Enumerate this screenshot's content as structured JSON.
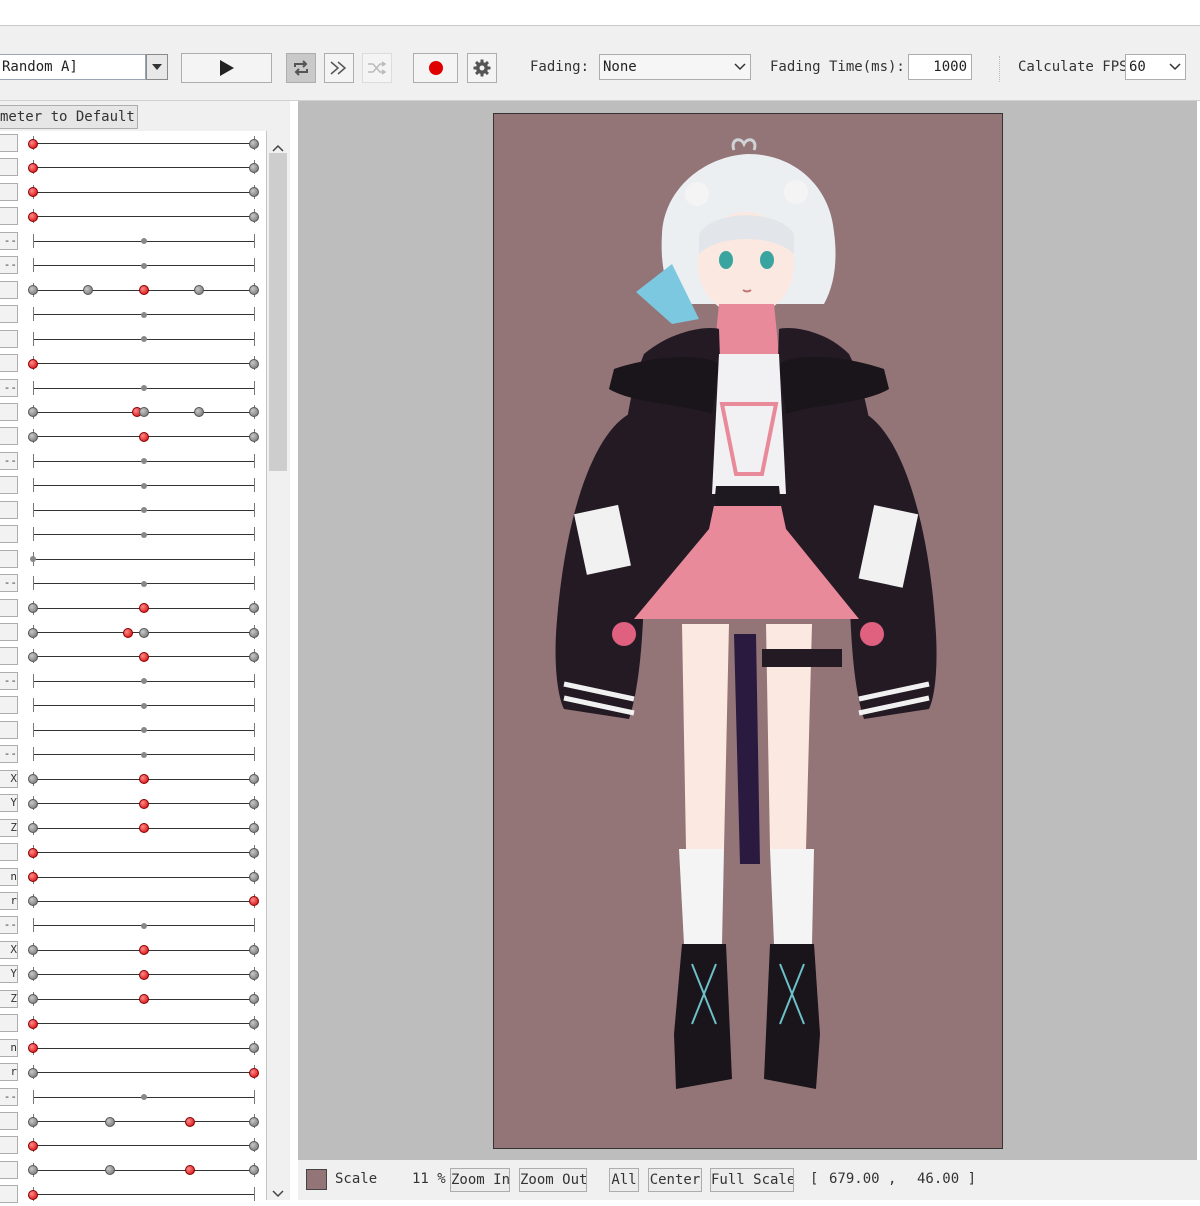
{
  "toolbar": {
    "motion_select": "Random A]",
    "fading_label": "Fading:",
    "fading_value": "None",
    "fading_time_label": "Fading Time(ms):",
    "fading_time_value": "1000",
    "fps_label": "Calculate FPS",
    "fps_value": "60",
    "play_icon": "play-icon",
    "loop_icon": "loop-icon",
    "skip_icon": "fast-forward-icon",
    "shuffle_icon": "shuffle-icon",
    "record_icon": "record-icon",
    "settings_icon": "gear-icon"
  },
  "left_panel": {
    "reset_button": "meter to Default",
    "rows": [
      {
        "suffix": "",
        "knobs": [
          {
            "v": 0,
            "c": "r"
          },
          {
            "v": 1,
            "c": "g"
          }
        ]
      },
      {
        "suffix": "",
        "knobs": [
          {
            "v": 0,
            "c": "r"
          },
          {
            "v": 1,
            "c": "g"
          }
        ]
      },
      {
        "suffix": "",
        "knobs": [
          {
            "v": 0,
            "c": "r"
          },
          {
            "v": 1,
            "c": "g"
          }
        ]
      },
      {
        "suffix": "",
        "knobs": [
          {
            "v": 0,
            "c": "r"
          },
          {
            "v": 1,
            "c": "g"
          }
        ]
      },
      {
        "suffix": "--",
        "knobs": [
          {
            "v": 0.5,
            "c": "m"
          }
        ]
      },
      {
        "suffix": "--",
        "knobs": [
          {
            "v": 0.5,
            "c": "m"
          }
        ]
      },
      {
        "suffix": "",
        "knobs": [
          {
            "v": 0,
            "c": "g"
          },
          {
            "v": 0.25,
            "c": "g"
          },
          {
            "v": 0.5,
            "c": "r"
          },
          {
            "v": 0.75,
            "c": "g"
          },
          {
            "v": 1,
            "c": "g"
          }
        ]
      },
      {
        "suffix": "",
        "knobs": [
          {
            "v": 0.5,
            "c": "m"
          }
        ]
      },
      {
        "suffix": "",
        "knobs": [
          {
            "v": 0.5,
            "c": "m"
          }
        ]
      },
      {
        "suffix": "",
        "knobs": [
          {
            "v": 0,
            "c": "r"
          },
          {
            "v": 1,
            "c": "g"
          }
        ]
      },
      {
        "suffix": "--",
        "knobs": [
          {
            "v": 0.5,
            "c": "m"
          }
        ]
      },
      {
        "suffix": "",
        "knobs": [
          {
            "v": 0,
            "c": "g"
          },
          {
            "v": 0.47,
            "c": "r"
          },
          {
            "v": 0.5,
            "c": "g"
          },
          {
            "v": 0.75,
            "c": "g"
          },
          {
            "v": 1,
            "c": "g"
          }
        ]
      },
      {
        "suffix": "",
        "knobs": [
          {
            "v": 0,
            "c": "g"
          },
          {
            "v": 0.5,
            "c": "r"
          },
          {
            "v": 1,
            "c": "g"
          }
        ]
      },
      {
        "suffix": "--",
        "knobs": [
          {
            "v": 0.5,
            "c": "m"
          }
        ]
      },
      {
        "suffix": "",
        "knobs": [
          {
            "v": 0.5,
            "c": "m"
          }
        ]
      },
      {
        "suffix": "",
        "knobs": [
          {
            "v": 0.5,
            "c": "m"
          }
        ]
      },
      {
        "suffix": "",
        "knobs": [
          {
            "v": 0.5,
            "c": "m"
          }
        ]
      },
      {
        "suffix": "",
        "knobs": [
          {
            "v": 0,
            "c": "m"
          }
        ]
      },
      {
        "suffix": "--",
        "knobs": [
          {
            "v": 0.5,
            "c": "m"
          }
        ]
      },
      {
        "suffix": "",
        "knobs": [
          {
            "v": 0,
            "c": "g"
          },
          {
            "v": 0.5,
            "c": "r"
          },
          {
            "v": 1,
            "c": "g"
          }
        ]
      },
      {
        "suffix": "",
        "knobs": [
          {
            "v": 0,
            "c": "g"
          },
          {
            "v": 0.43,
            "c": "r"
          },
          {
            "v": 0.5,
            "c": "g"
          },
          {
            "v": 1,
            "c": "g"
          }
        ]
      },
      {
        "suffix": "",
        "knobs": [
          {
            "v": 0,
            "c": "g"
          },
          {
            "v": 0.5,
            "c": "r"
          },
          {
            "v": 1,
            "c": "g"
          }
        ]
      },
      {
        "suffix": "--",
        "knobs": [
          {
            "v": 0.5,
            "c": "m"
          }
        ]
      },
      {
        "suffix": "",
        "knobs": [
          {
            "v": 0.5,
            "c": "m"
          }
        ]
      },
      {
        "suffix": "",
        "knobs": [
          {
            "v": 0.5,
            "c": "m"
          }
        ]
      },
      {
        "suffix": "--",
        "knobs": [
          {
            "v": 0.5,
            "c": "m"
          }
        ]
      },
      {
        "suffix": "X",
        "knobs": [
          {
            "v": 0,
            "c": "g"
          },
          {
            "v": 0.5,
            "c": "r"
          },
          {
            "v": 1,
            "c": "g"
          }
        ]
      },
      {
        "suffix": "Y",
        "knobs": [
          {
            "v": 0,
            "c": "g"
          },
          {
            "v": 0.5,
            "c": "r"
          },
          {
            "v": 1,
            "c": "g"
          }
        ]
      },
      {
        "suffix": "Z",
        "knobs": [
          {
            "v": 0,
            "c": "g"
          },
          {
            "v": 0.5,
            "c": "r"
          },
          {
            "v": 1,
            "c": "g"
          }
        ]
      },
      {
        "suffix": "",
        "knobs": [
          {
            "v": 0,
            "c": "r"
          },
          {
            "v": 1,
            "c": "g"
          }
        ]
      },
      {
        "suffix": "n",
        "knobs": [
          {
            "v": 0,
            "c": "r"
          },
          {
            "v": 1,
            "c": "g"
          }
        ]
      },
      {
        "suffix": "r",
        "knobs": [
          {
            "v": 0,
            "c": "g"
          },
          {
            "v": 1,
            "c": "r"
          }
        ]
      },
      {
        "suffix": "--",
        "knobs": [
          {
            "v": 0.5,
            "c": "m"
          }
        ]
      },
      {
        "suffix": "X",
        "knobs": [
          {
            "v": 0,
            "c": "g"
          },
          {
            "v": 0.5,
            "c": "r"
          },
          {
            "v": 1,
            "c": "g"
          }
        ]
      },
      {
        "suffix": "Y",
        "knobs": [
          {
            "v": 0,
            "c": "g"
          },
          {
            "v": 0.5,
            "c": "r"
          },
          {
            "v": 1,
            "c": "g"
          }
        ]
      },
      {
        "suffix": "Z",
        "knobs": [
          {
            "v": 0,
            "c": "g"
          },
          {
            "v": 0.5,
            "c": "r"
          },
          {
            "v": 1,
            "c": "g"
          }
        ]
      },
      {
        "suffix": "",
        "knobs": [
          {
            "v": 0,
            "c": "r"
          },
          {
            "v": 1,
            "c": "g"
          }
        ]
      },
      {
        "suffix": "n",
        "knobs": [
          {
            "v": 0,
            "c": "r"
          },
          {
            "v": 1,
            "c": "g"
          }
        ]
      },
      {
        "suffix": "r",
        "knobs": [
          {
            "v": 0,
            "c": "g"
          },
          {
            "v": 1,
            "c": "r"
          }
        ]
      },
      {
        "suffix": "--",
        "knobs": [
          {
            "v": 0.5,
            "c": "m"
          }
        ]
      },
      {
        "suffix": "",
        "knobs": [
          {
            "v": 0,
            "c": "g"
          },
          {
            "v": 0.35,
            "c": "g"
          },
          {
            "v": 0.71,
            "c": "r"
          },
          {
            "v": 1,
            "c": "g"
          }
        ]
      },
      {
        "suffix": "",
        "knobs": [
          {
            "v": 0,
            "c": "r"
          },
          {
            "v": 1,
            "c": "g"
          }
        ]
      },
      {
        "suffix": "",
        "knobs": [
          {
            "v": 0,
            "c": "g"
          },
          {
            "v": 0.35,
            "c": "g"
          },
          {
            "v": 0.71,
            "c": "r"
          },
          {
            "v": 1,
            "c": "g"
          }
        ]
      },
      {
        "suffix": "",
        "knobs": [
          {
            "v": 0,
            "c": "r"
          }
        ]
      }
    ]
  },
  "viewer": {
    "background_color": "#937578",
    "character_image": "anime-character-model"
  },
  "bottom_bar": {
    "scale_label": "Scale",
    "scale_value": "11 %",
    "zoom_in": "Zoom In",
    "zoom_out": "Zoom Out",
    "all": "All",
    "center": "Center",
    "full_scale": "Full Scale",
    "coord_open": "[",
    "coord_x": "679.00 ,",
    "coord_y": "46.00 ]"
  },
  "colors": {
    "knob_red": "#d00000",
    "knob_gray": "#6d6d6d",
    "record_red": "#e00000",
    "panel_bg": "#f0f0f0"
  }
}
